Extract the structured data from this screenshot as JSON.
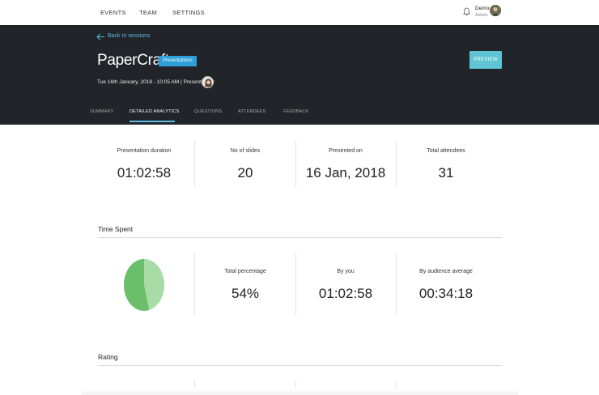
{
  "nav": {
    "links": [
      "EVENTS",
      "TEAM",
      "SETTINGS"
    ],
    "user_name": "Demo",
    "user_role": "Admin"
  },
  "header": {
    "back_label": "Back to sessions",
    "title": "PaperCraft",
    "badge": "Presentations",
    "meta": "Tue 16th January, 2018 - 10:05 AM | Presented by",
    "preview_label": "PREVIEW",
    "tabs": [
      {
        "label": "SUMMARY",
        "active": false
      },
      {
        "label": "DETAILED ANALYTICS",
        "active": true
      },
      {
        "label": "QUESTIONS",
        "active": false
      },
      {
        "label": "ATTENDEES",
        "active": false
      },
      {
        "label": "FEEDBACK",
        "active": false
      }
    ]
  },
  "stats": [
    {
      "label": "Presentation duration",
      "value": "01:02:58"
    },
    {
      "label": "No of slides",
      "value": "20"
    },
    {
      "label": "Presented on",
      "value": "16 Jan, 2018"
    },
    {
      "label": "Total attendees",
      "value": "31"
    }
  ],
  "time_spent": {
    "title": "Time Spent",
    "percent_value": 0.54,
    "items": [
      {
        "label": "Total percentage",
        "value": "54%"
      },
      {
        "label": "By you",
        "value": "01:02:58"
      },
      {
        "label": "By audience average",
        "value": "00:34:18"
      }
    ],
    "colors": {
      "primary": "#6cbf6a",
      "secondary": "#a8dba5"
    }
  },
  "rating": {
    "title": "Rating"
  }
}
